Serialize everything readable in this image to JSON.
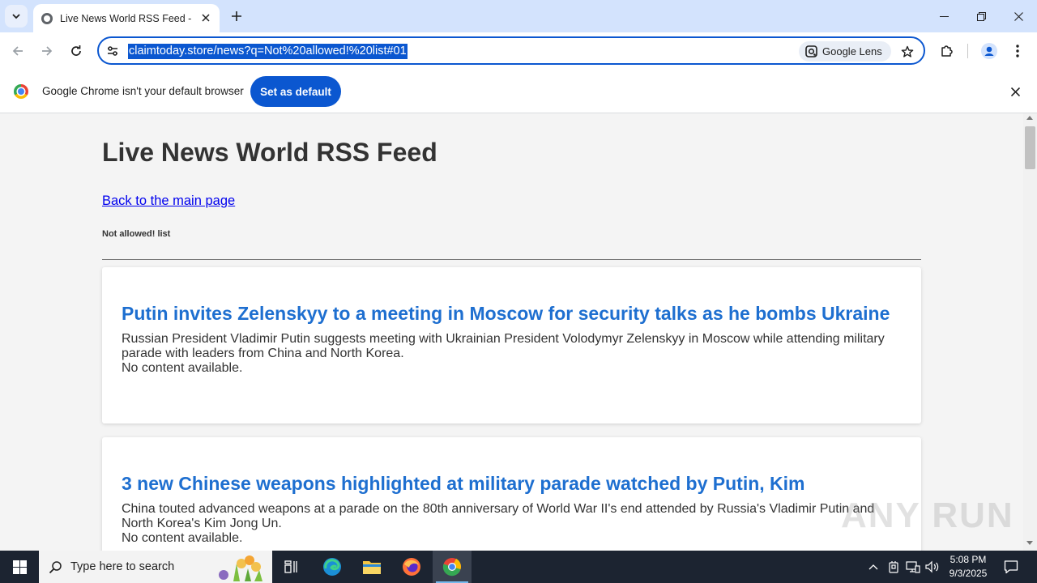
{
  "browser": {
    "tab_title": "Live News World RSS Feed - do",
    "url": "claimtoday.store/news?q=Not%20allowed!%20list#01",
    "lens_label": "Google Lens"
  },
  "infobar": {
    "message": "Google Chrome isn't your default browser",
    "button": "Set as default"
  },
  "page": {
    "title": "Live News World RSS Feed",
    "back_link": "Back to the main page",
    "subtitle": "Not allowed! list",
    "articles": [
      {
        "title": "Putin invites Zelenskyy to a meeting in Moscow for security talks as he bombs Ukraine",
        "description": "Russian President Vladimir Putin suggests meeting with Ukrainian President Volodymyr Zelenskyy in Moscow while attending military parade with leaders from China and North Korea.",
        "content": "No content available."
      },
      {
        "title": "3 new Chinese weapons highlighted at military parade watched by Putin, Kim",
        "description": "China touted advanced weapons at a parade on the 80th anniversary of World War II's end attended by Russia's Vladimir Putin and North Korea's Kim Jong Un.",
        "content": "No content available."
      }
    ]
  },
  "watermark": "ANY RUN",
  "taskbar": {
    "search_placeholder": "Type here to search",
    "time": "5:08 PM",
    "date": "9/3/2025"
  },
  "colors": {
    "accent": "#0b57d0",
    "tab_strip": "#d3e3fd",
    "article_title": "#1e6fd0",
    "taskbar": "#1c2431"
  }
}
